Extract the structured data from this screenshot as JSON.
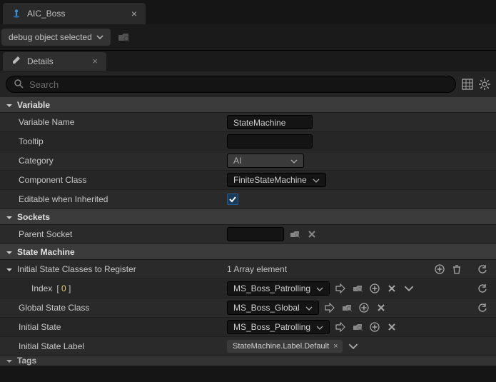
{
  "tab": {
    "title": "AIC_Boss"
  },
  "toolbar": {
    "debug_label": "debug object selected"
  },
  "details": {
    "title": "Details",
    "search_placeholder": "Search"
  },
  "sections": {
    "variable": "Variable",
    "sockets": "Sockets",
    "statemachine": "State Machine",
    "tags": "Tags"
  },
  "variable": {
    "name_label": "Variable Name",
    "name_value": "StateMachine",
    "tooltip_label": "Tooltip",
    "tooltip_value": "",
    "category_label": "Category",
    "category_value": "AI",
    "component_label": "Component Class",
    "component_value": "FiniteStateMachine",
    "editable_label": "Editable when Inherited",
    "editable_checked": true
  },
  "sockets": {
    "parent_label": "Parent Socket"
  },
  "statemachine": {
    "initial_classes_label": "Initial State Classes to Register",
    "array_count": "1 Array element",
    "index_label": "Index",
    "index_value": "0",
    "index_dropdown": "MS_Boss_Patrolling",
    "global_label": "Global State Class",
    "global_value": "MS_Boss_Global",
    "initial_state_label": "Initial State",
    "initial_state_value": "MS_Boss_Patrolling",
    "initial_label_label": "Initial State Label",
    "initial_label_value": "StateMachine.Label.Default"
  }
}
